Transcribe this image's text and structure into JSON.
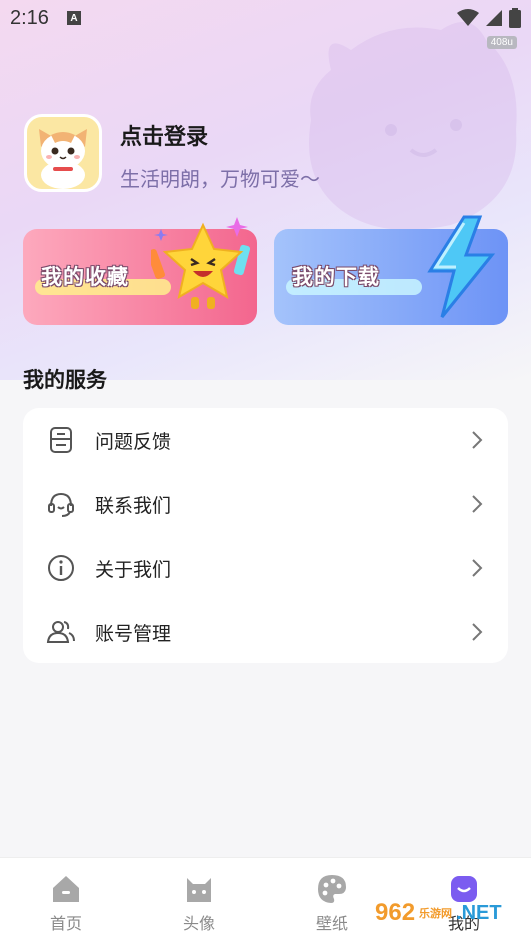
{
  "status_bar": {
    "time": "2:16",
    "notification_letter": "A",
    "speed": "408u"
  },
  "profile": {
    "login": "点击登录",
    "motto": "生活明朗，万物可爱～"
  },
  "cards": {
    "favorites": "我的收藏",
    "downloads": "我的下载"
  },
  "services": {
    "title": "我的服务",
    "items": [
      {
        "label": "问题反馈",
        "icon": "feedback-icon"
      },
      {
        "label": "联系我们",
        "icon": "headset-icon"
      },
      {
        "label": "关于我们",
        "icon": "info-icon"
      },
      {
        "label": "账号管理",
        "icon": "users-icon"
      }
    ]
  },
  "bottom_nav": [
    {
      "label": "首页",
      "icon": "home-icon"
    },
    {
      "label": "头像",
      "icon": "cat-icon"
    },
    {
      "label": "壁纸",
      "icon": "palette-icon"
    },
    {
      "label": "我的",
      "icon": "profile-icon",
      "active": true
    }
  ],
  "watermark": {
    "number": "962",
    "domain": ".NET",
    "sub": "乐游网"
  },
  "colors": {
    "accent": "#7d6fa8",
    "fav_card": "#f3668e",
    "dl_card": "#6d93f6",
    "active_nav": "#7b5cf0"
  }
}
